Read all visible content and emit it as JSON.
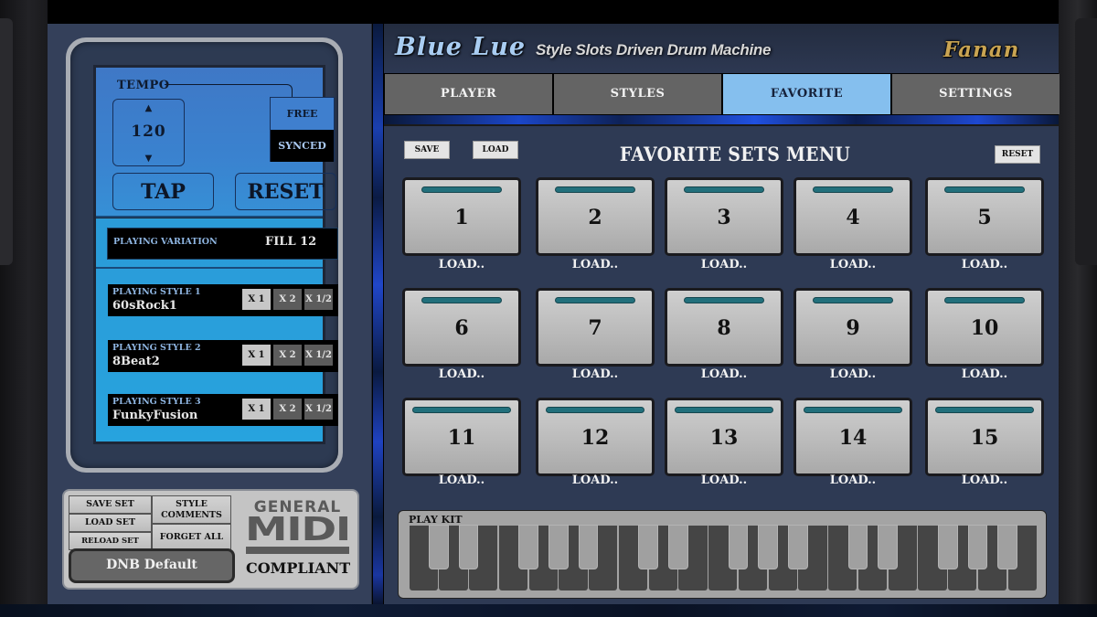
{
  "app": {
    "title": "Blue Lue",
    "subtitle": "Style Slots Driven Drum Machine",
    "brand": "Fanan"
  },
  "tempo": {
    "label": "TEMPO",
    "value": "120",
    "up_icon": "▲",
    "down_icon": "▼",
    "modes": [
      "FREE",
      "SYNCED"
    ],
    "active_mode": "SYNCED",
    "tap_label": "TAP",
    "reset_label": "RESET"
  },
  "variation": {
    "label": "PLAYING VARIATION",
    "value": "FILL 12"
  },
  "styles": [
    {
      "label": "PLAYING STYLE 1",
      "name": "60sRock1",
      "multipliers": [
        "X 1",
        "X 2",
        "X 1/2"
      ],
      "active": "X 1"
    },
    {
      "label": "PLAYING STYLE 2",
      "name": "8Beat2",
      "multipliers": [
        "X 1",
        "X 2",
        "X 1/2"
      ],
      "active": "X 1"
    },
    {
      "label": "PLAYING STYLE 3",
      "name": "FunkyFusion",
      "multipliers": [
        "X 1",
        "X 2",
        "X 1/2"
      ],
      "active": "X 1"
    }
  ],
  "set_controls": {
    "save_set": "SAVE SET",
    "load_set": "LOAD SET",
    "reload_set": "RELOAD SET",
    "style_comments_line1": "STYLE",
    "style_comments_line2": "COMMENTS",
    "forget_all": "FORGET ALL",
    "current_set": "DNB Default"
  },
  "gm_logo": {
    "general": "GENERAL",
    "midi": "MIDI",
    "compliant": "COMPLIANT"
  },
  "tabs": [
    {
      "label": "PLAYER",
      "active": false
    },
    {
      "label": "STYLES",
      "active": false
    },
    {
      "label": "FAVORITE",
      "active": true
    },
    {
      "label": "SETTINGS",
      "active": false
    }
  ],
  "favorites": {
    "title": "FAVORITE SETS MENU",
    "save_label": "SAVE",
    "load_label": "LOAD",
    "reset_label": "RESET",
    "slots": [
      {
        "number": "1",
        "caption": "LOAD.."
      },
      {
        "number": "2",
        "caption": "LOAD.."
      },
      {
        "number": "3",
        "caption": "LOAD.."
      },
      {
        "number": "4",
        "caption": "LOAD.."
      },
      {
        "number": "5",
        "caption": "LOAD.."
      },
      {
        "number": "6",
        "caption": "LOAD.."
      },
      {
        "number": "7",
        "caption": "LOAD.."
      },
      {
        "number": "8",
        "caption": "LOAD.."
      },
      {
        "number": "9",
        "caption": "LOAD.."
      },
      {
        "number": "10",
        "caption": "LOAD.."
      },
      {
        "number": "11",
        "caption": "LOAD.."
      },
      {
        "number": "12",
        "caption": "LOAD.."
      },
      {
        "number": "13",
        "caption": "LOAD.."
      },
      {
        "number": "14",
        "caption": "LOAD.."
      },
      {
        "number": "15",
        "caption": "LOAD.."
      }
    ]
  },
  "play_kit": {
    "label": "PLAY KIT",
    "octaves": 3
  },
  "colors": {
    "accent_tab": "#85bfee",
    "pad_led": "#22707c",
    "panel_bg": "#2e3a54"
  }
}
